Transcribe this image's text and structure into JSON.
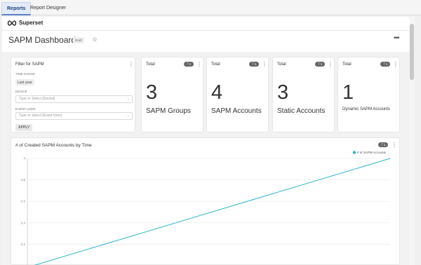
{
  "tabs": [
    {
      "label": "Reports",
      "active": true
    },
    {
      "label": "Report Designer",
      "active": false
    }
  ],
  "brand": {
    "name": "Superset"
  },
  "dashboard": {
    "title": "SAPM Dashboard",
    "status": "Draft"
  },
  "filter": {
    "title": "Filter for SAPM",
    "time_range_label": "TIME RANGE",
    "time_range_value": "Last year",
    "device_label": "DEVICE",
    "device_placeholder": "Type or Select [Device]",
    "event_user_label": "EVENT USER",
    "event_user_placeholder": "Type or Select [Event User]",
    "apply_label": "APPLY"
  },
  "kpis": [
    {
      "title": "Total",
      "badge": "1",
      "value": "3",
      "label": "SAPM Groups"
    },
    {
      "title": "Total",
      "badge": "1",
      "value": "4",
      "label": "SAPM Accounts"
    },
    {
      "title": "Total",
      "badge": "1",
      "value": "3",
      "label": "Static Accounts"
    },
    {
      "title": "Total",
      "badge": "1",
      "value": "1",
      "label": "Dynamic SAPM Accounts"
    }
  ],
  "line_chart_card": {
    "title": "# of Created SAPM Accounts by Time",
    "badge": "1"
  },
  "colors": {
    "accent": "#5b7fc7",
    "series": "#2fb5c9"
  },
  "chart_data": {
    "type": "line",
    "title": "# of Created SAPM Accounts by Time",
    "xlabel": "",
    "ylabel": "",
    "ylim": [
      3,
      4
    ],
    "y_ticks": [
      "4",
      "3.8",
      "3.6",
      "3.4",
      "3.2"
    ],
    "grid": true,
    "legend_position": "top-right",
    "series": [
      {
        "name": "# of SAPM Accounts",
        "x": [
          0,
          1
        ],
        "values": [
          3,
          4
        ]
      }
    ]
  }
}
